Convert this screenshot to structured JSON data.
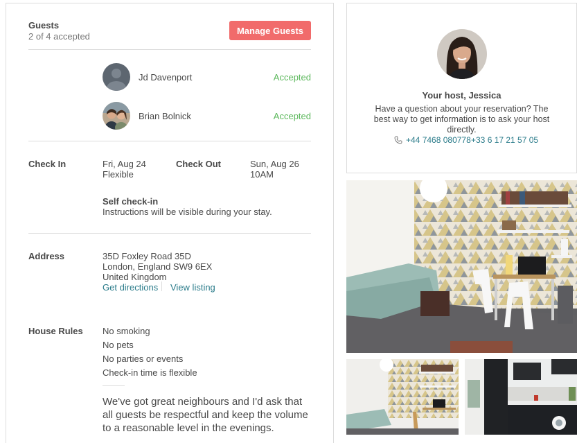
{
  "guests": {
    "title": "Guests",
    "subtitle": "2 of 4 accepted",
    "manage_label": "Manage Guests",
    "list": [
      {
        "name": "Jd Davenport",
        "status": "Accepted"
      },
      {
        "name": "Brian Bolnick",
        "status": "Accepted"
      }
    ]
  },
  "checkin": {
    "label": "Check In",
    "date": "Fri, Aug 24",
    "time": "Flexible"
  },
  "checkout": {
    "label": "Check Out",
    "date": "Sun, Aug 26",
    "time": "10AM"
  },
  "self_checkin": {
    "title": "Self check-in",
    "text": "Instructions will be visible during your stay."
  },
  "address": {
    "label": "Address",
    "line1": "35D Foxley Road 35D",
    "line2": "London, England SW9 6EX",
    "line3": "United Kingdom",
    "directions_label": "Get directions",
    "listing_label": "View listing"
  },
  "house_rules": {
    "label": "House Rules",
    "rules": [
      "No smoking",
      "No pets",
      "No parties or events",
      "Check-in time is flexible"
    ],
    "note": "We've got great neighbours and I'd ask that all guests be respectful and keep the volume to a reasonable level in the evenings."
  },
  "host": {
    "title": "Your host, Jessica",
    "description": "Have a question about your reservation? The best way to get information is to ask your host directly.",
    "phone1": "+44 7468 080778",
    "phone2": "+33 6 17 21 57 05",
    "icon": "phone-icon"
  },
  "colors": {
    "accent": "#f16b6b",
    "link": "#2a7b8a",
    "accepted": "#5cb85c"
  }
}
